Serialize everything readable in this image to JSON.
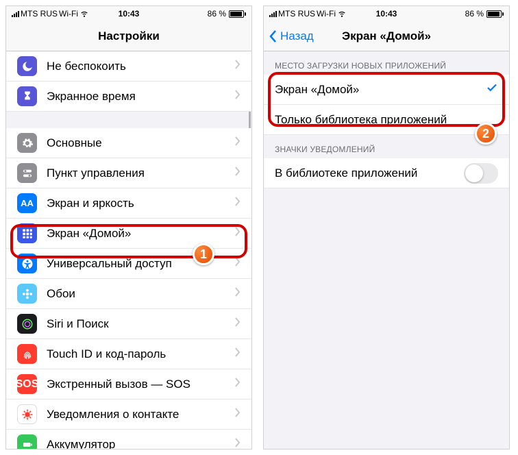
{
  "status": {
    "carrier": "MTS RUS",
    "net": "Wi-Fi",
    "time": "10:43",
    "battery": "86 %"
  },
  "left": {
    "title": "Настройки",
    "rows": [
      {
        "label": "Не беспокоить",
        "icon": "moon"
      },
      {
        "label": "Экранное время",
        "icon": "hourglass"
      },
      {
        "label": "Основные",
        "icon": "gear"
      },
      {
        "label": "Пункт управления",
        "icon": "switches"
      },
      {
        "label": "Экран и яркость",
        "icon": "aa"
      },
      {
        "label": "Экран «Домой»",
        "icon": "grid"
      },
      {
        "label": "Универсальный доступ",
        "icon": "accessibility"
      },
      {
        "label": "Обои",
        "icon": "flower"
      },
      {
        "label": "Siri и Поиск",
        "icon": "siri"
      },
      {
        "label": "Touch ID и код-пароль",
        "icon": "fingerprint"
      },
      {
        "label": "Экстренный вызов — SOS",
        "icon": "sos"
      },
      {
        "label": "Уведомления о контакте",
        "icon": "virus"
      },
      {
        "label": "Аккумулятор",
        "icon": "battery"
      }
    ]
  },
  "right": {
    "back": "Назад",
    "title": "Экран «Домой»",
    "section1": "МЕСТО ЗАГРУЗКИ НОВЫХ ПРИЛОЖЕНИЙ",
    "opt1": "Экран «Домой»",
    "opt2": "Только библиотека приложений",
    "section2": "ЗНАЧКИ УВЕДОМЛЕНИЙ",
    "toggleLabel": "В библиотеке приложений"
  },
  "annotations": {
    "badge1": "1",
    "badge2": "2"
  }
}
